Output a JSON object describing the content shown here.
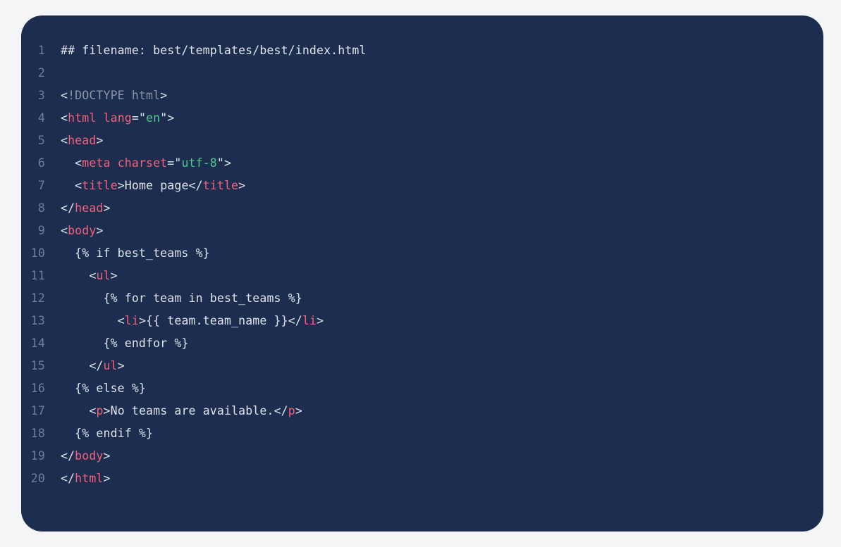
{
  "theme": {
    "page_background": "#f4f5f7",
    "card_background": "#1d2d4f",
    "line_number_color": "#6f7f9b",
    "default_text_color": "#dfe4ec",
    "tag_color": "#f1617a",
    "string_color": "#4ec98f",
    "doctype_color": "#8b94a5"
  },
  "code_block": {
    "language": "html",
    "first_line_number": 1,
    "last_line_number": 20,
    "lines": [
      {
        "number": "1",
        "text": "## filename: best/templates/best/index.html",
        "tokens": [
          {
            "kind": "comment",
            "text": "## filename: best/templates/best/index.html"
          }
        ]
      },
      {
        "number": "2",
        "text": "",
        "tokens": []
      },
      {
        "number": "3",
        "text": "<!DOCTYPE html>",
        "tokens": [
          {
            "kind": "punct",
            "text": "<"
          },
          {
            "kind": "doctype",
            "text": "!DOCTYPE html"
          },
          {
            "kind": "punct",
            "text": ">"
          }
        ]
      },
      {
        "number": "4",
        "text": "<html lang=\"en\">",
        "tokens": [
          {
            "kind": "punct",
            "text": "<"
          },
          {
            "kind": "tag",
            "text": "html"
          },
          {
            "kind": "plain",
            "text": " "
          },
          {
            "kind": "attr",
            "text": "lang"
          },
          {
            "kind": "punct",
            "text": "=\""
          },
          {
            "kind": "string",
            "text": "en"
          },
          {
            "kind": "punct",
            "text": "\">"
          }
        ]
      },
      {
        "number": "5",
        "text": "<head>",
        "tokens": [
          {
            "kind": "punct",
            "text": "<"
          },
          {
            "kind": "tag",
            "text": "head"
          },
          {
            "kind": "punct",
            "text": ">"
          }
        ]
      },
      {
        "number": "6",
        "text": "  <meta charset=\"utf-8\">",
        "tokens": [
          {
            "kind": "plain",
            "text": "  "
          },
          {
            "kind": "punct",
            "text": "<"
          },
          {
            "kind": "tag",
            "text": "meta"
          },
          {
            "kind": "plain",
            "text": " "
          },
          {
            "kind": "attr",
            "text": "charset"
          },
          {
            "kind": "punct",
            "text": "=\""
          },
          {
            "kind": "string",
            "text": "utf-8"
          },
          {
            "kind": "punct",
            "text": "\">"
          }
        ]
      },
      {
        "number": "7",
        "text": "  <title>Home page</title>",
        "tokens": [
          {
            "kind": "plain",
            "text": "  "
          },
          {
            "kind": "punct",
            "text": "<"
          },
          {
            "kind": "tag",
            "text": "title"
          },
          {
            "kind": "punct",
            "text": ">"
          },
          {
            "kind": "text",
            "text": "Home page"
          },
          {
            "kind": "punct",
            "text": "</"
          },
          {
            "kind": "tag",
            "text": "title"
          },
          {
            "kind": "punct",
            "text": ">"
          }
        ]
      },
      {
        "number": "8",
        "text": "</head>",
        "tokens": [
          {
            "kind": "punct",
            "text": "</"
          },
          {
            "kind": "tag",
            "text": "head"
          },
          {
            "kind": "punct",
            "text": ">"
          }
        ]
      },
      {
        "number": "9",
        "text": "<body>",
        "tokens": [
          {
            "kind": "punct",
            "text": "<"
          },
          {
            "kind": "tag",
            "text": "body"
          },
          {
            "kind": "punct",
            "text": ">"
          }
        ]
      },
      {
        "number": "10",
        "text": "  {% if best_teams %}",
        "tokens": [
          {
            "kind": "plain",
            "text": "  "
          },
          {
            "kind": "jinja",
            "text": "{% if best_teams %}"
          }
        ]
      },
      {
        "number": "11",
        "text": "    <ul>",
        "tokens": [
          {
            "kind": "plain",
            "text": "    "
          },
          {
            "kind": "punct",
            "text": "<"
          },
          {
            "kind": "tag",
            "text": "ul"
          },
          {
            "kind": "punct",
            "text": ">"
          }
        ]
      },
      {
        "number": "12",
        "text": "      {% for team in best_teams %}",
        "tokens": [
          {
            "kind": "plain",
            "text": "      "
          },
          {
            "kind": "jinja",
            "text": "{% for team in best_teams %}"
          }
        ]
      },
      {
        "number": "13",
        "text": "        <li>{{ team.team_name }}</li>",
        "tokens": [
          {
            "kind": "plain",
            "text": "        "
          },
          {
            "kind": "punct",
            "text": "<"
          },
          {
            "kind": "tag",
            "text": "li"
          },
          {
            "kind": "punct",
            "text": ">"
          },
          {
            "kind": "jinja",
            "text": "{{ team.team_name }}"
          },
          {
            "kind": "punct",
            "text": "</"
          },
          {
            "kind": "tag",
            "text": "li"
          },
          {
            "kind": "punct",
            "text": ">"
          }
        ]
      },
      {
        "number": "14",
        "text": "      {% endfor %}",
        "tokens": [
          {
            "kind": "plain",
            "text": "      "
          },
          {
            "kind": "jinja",
            "text": "{% endfor %}"
          }
        ]
      },
      {
        "number": "15",
        "text": "    </ul>",
        "tokens": [
          {
            "kind": "plain",
            "text": "    "
          },
          {
            "kind": "punct",
            "text": "</"
          },
          {
            "kind": "tag",
            "text": "ul"
          },
          {
            "kind": "punct",
            "text": ">"
          }
        ]
      },
      {
        "number": "16",
        "text": "  {% else %}",
        "tokens": [
          {
            "kind": "plain",
            "text": "  "
          },
          {
            "kind": "jinja",
            "text": "{% else %}"
          }
        ]
      },
      {
        "number": "17",
        "text": "    <p>No teams are available.</p>",
        "tokens": [
          {
            "kind": "plain",
            "text": "    "
          },
          {
            "kind": "punct",
            "text": "<"
          },
          {
            "kind": "tag",
            "text": "p"
          },
          {
            "kind": "punct",
            "text": ">"
          },
          {
            "kind": "text",
            "text": "No teams are available."
          },
          {
            "kind": "punct",
            "text": "</"
          },
          {
            "kind": "tag",
            "text": "p"
          },
          {
            "kind": "punct",
            "text": ">"
          }
        ]
      },
      {
        "number": "18",
        "text": "  {% endif %}",
        "tokens": [
          {
            "kind": "plain",
            "text": "  "
          },
          {
            "kind": "jinja",
            "text": "{% endif %}"
          }
        ]
      },
      {
        "number": "19",
        "text": "</body>",
        "tokens": [
          {
            "kind": "punct",
            "text": "</"
          },
          {
            "kind": "tag",
            "text": "body"
          },
          {
            "kind": "punct",
            "text": ">"
          }
        ]
      },
      {
        "number": "20",
        "text": "</html>",
        "tokens": [
          {
            "kind": "punct",
            "text": "</"
          },
          {
            "kind": "tag",
            "text": "html"
          },
          {
            "kind": "punct",
            "text": ">"
          }
        ]
      }
    ]
  }
}
